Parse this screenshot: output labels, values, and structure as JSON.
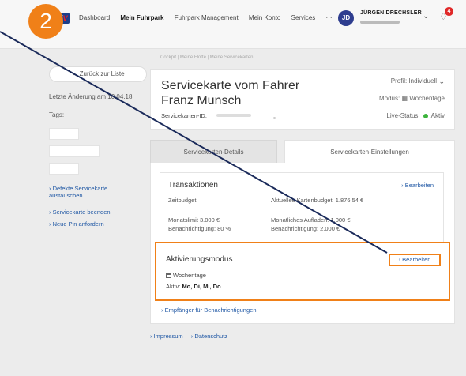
{
  "step_number": "2",
  "topbar": {
    "logo": {
      "main": "DK",
      "accent": "V"
    },
    "nav": [
      "Dashboard",
      "Mein Fuhrpark",
      "Fuhrpark Management",
      "Mein Konto",
      "Services",
      "···"
    ],
    "active_nav": "Mein Fuhrpark",
    "avatar_initials": "JD",
    "user_name": "JÜRGEN DRECHSLER",
    "notification_count": "4"
  },
  "breadcrumb": "Cockpit | Meine Flotte | Meine Servicekarten",
  "sidebar": {
    "back_label": "←  Zurück zur Liste",
    "last_change": "Letzte Änderung am 10.04.18",
    "tags_label": "Tags:",
    "links": [
      "› Defekte Servicekarte austauschen",
      "› Servicekarte beenden",
      "› Neue Pin anfordern"
    ]
  },
  "header": {
    "title_line1": "Servicekarte vom Fahrer",
    "title_line2": "Franz Munsch",
    "id_label": "Servicekarten-ID:",
    "profile": "Profil: Individuell",
    "mode": "Modus: ▦ Wochentage",
    "status_label": "Live-Status:",
    "status_value": "Aktiv"
  },
  "tabs": {
    "details": "Servicekarten-Details",
    "settings": "Servicekarten-Einstellungen"
  },
  "transaktionen": {
    "title": "Transaktionen",
    "edit": "› Bearbeiten",
    "zeitbudget": "Zeitbudget:",
    "aktuelles_budget": "Aktuelles Kartenbudget: 1.876,54 €",
    "monatslimit": "Monatslimit 3.000 €",
    "benachrichtigung": "Benachrichtigung: 80 %",
    "monatliches_aufladen": "Monatliches Aufladen: 1.000 €",
    "benachrichtigung2": "Benachrichtigung: 2.000 €"
  },
  "aktivierung": {
    "title": "Aktivierungsmodus",
    "edit": "› Bearbeiten",
    "mode": "Wochentage",
    "active_label": "Aktiv:",
    "active_days": "Mo, Di, Mi, Do"
  },
  "empfaenger_link": "› Empfänger für Benachrichtigungen",
  "footer": [
    "› Impressum",
    "› Datenschutz"
  ],
  "colors": {
    "accent": "#f08018",
    "link": "#1f57a4",
    "status": "#3cb43c",
    "brand": "#1d3f8a"
  }
}
